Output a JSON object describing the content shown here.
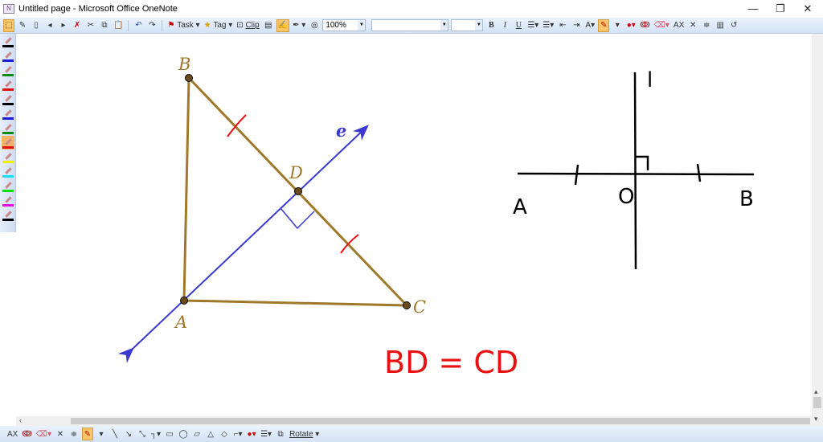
{
  "window": {
    "title": "Untitled page - Microsoft Office OneNote",
    "minimize": "—",
    "restore": "❐",
    "close": "✕"
  },
  "toolbar": {
    "task_label": "Task",
    "tag_label": "Tag",
    "clip_label": "Clip",
    "zoom_value": "100%",
    "font_value": "",
    "size_value": "",
    "bold": "B",
    "italic": "I",
    "underline": "U",
    "superscript": "AX"
  },
  "pens": [
    {
      "color": "#000000"
    },
    {
      "color": "#1a1ae0"
    },
    {
      "color": "#118a11"
    },
    {
      "color": "#e01010"
    },
    {
      "color": "#000000"
    },
    {
      "color": "#1a1ae0"
    },
    {
      "color": "#118a11"
    },
    {
      "color": "#e01010",
      "selected": true
    },
    {
      "color": "#f0f000"
    },
    {
      "color": "#10e0f0"
    },
    {
      "color": "#10e010"
    },
    {
      "color": "#e010e0"
    },
    {
      "color": "#000000"
    }
  ],
  "drawing": {
    "left_figure": {
      "B": "B",
      "A": "A",
      "C": "C",
      "D": "D",
      "e": "e",
      "line_color": "#a0782a",
      "axis_color": "#3a3ad0"
    },
    "right_figure": {
      "l": "l",
      "A": "A",
      "O": "O",
      "B": "B"
    },
    "equation": "BD = CD",
    "ink_color": "#e81010"
  },
  "bottombar": {
    "rotate_label": "Rotate"
  }
}
